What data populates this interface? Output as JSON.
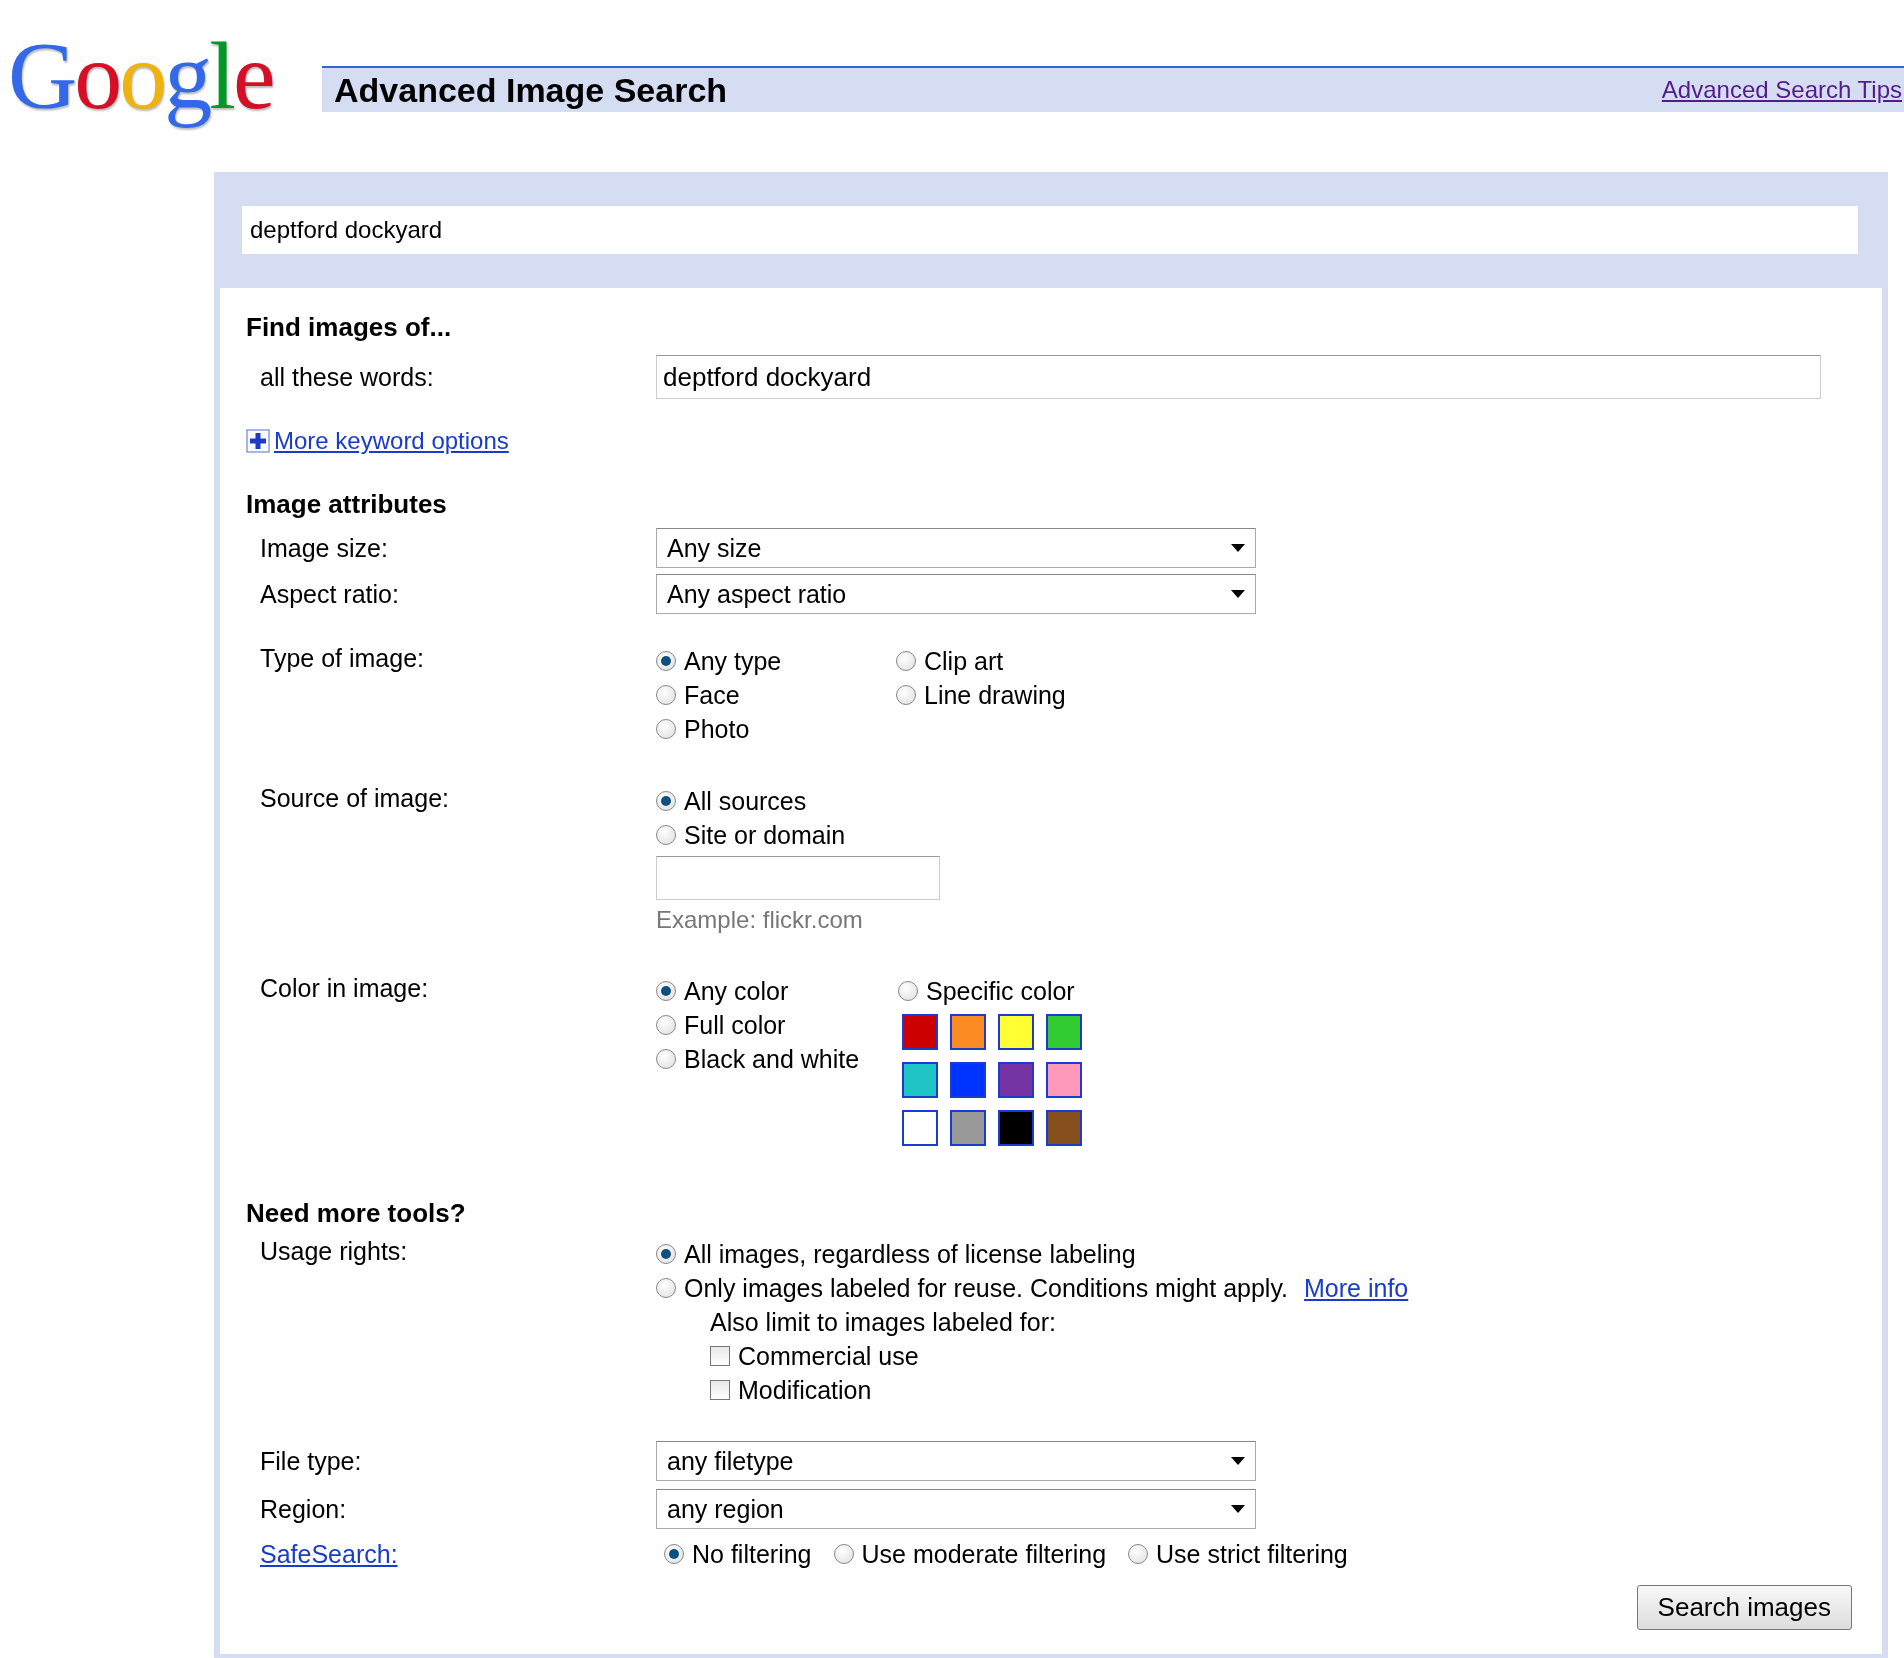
{
  "logo": "Google",
  "header": {
    "title": "Advanced Image Search",
    "tips_link": "Advanced Search Tips"
  },
  "top_query": {
    "value": "deptford dockyard"
  },
  "find_section": {
    "heading": "Find images of...",
    "label": "all these words:",
    "value": "deptford dockyard",
    "more_link": "More keyword options"
  },
  "attributes_section": {
    "heading": "Image attributes",
    "selects": [
      {
        "label": "Image size:",
        "value": "Any size"
      },
      {
        "label": "Aspect ratio:",
        "value": "Any aspect ratio"
      }
    ],
    "type_of_image": {
      "label": "Type of image:",
      "options": [
        {
          "label": "Any type",
          "selected": true
        },
        {
          "label": "Face",
          "selected": false
        },
        {
          "label": "Photo",
          "selected": false
        },
        {
          "label": "Clip art",
          "selected": false
        },
        {
          "label": "Line drawing",
          "selected": false
        }
      ]
    },
    "source_of_image": {
      "label": "Source of image:",
      "options": [
        {
          "label": "All sources",
          "selected": true
        },
        {
          "label": "Site or domain",
          "selected": false
        }
      ],
      "example": "Example: flickr.com"
    },
    "color_in_image": {
      "label": "Color in image:",
      "options": [
        {
          "label": "Any color",
          "selected": true
        },
        {
          "label": "Full color",
          "selected": false
        },
        {
          "label": "Black and white",
          "selected": false
        }
      ],
      "specific": {
        "label": "Specific color",
        "selected": false
      },
      "swatches": [
        {
          "color": "#cc0000"
        },
        {
          "color": "#fb8c24"
        },
        {
          "color": "#ffff33"
        },
        {
          "color": "#33cc33"
        },
        {
          "color": "#1fc4c4"
        },
        {
          "color": "#0033ff"
        },
        {
          "color": "#7633a3"
        },
        {
          "color": "#ff99bb"
        },
        {
          "color": "#ffffff"
        },
        {
          "color": "#999999"
        },
        {
          "color": "#000000"
        },
        {
          "color": "#85501e"
        }
      ]
    }
  },
  "tools_section": {
    "heading": "Need more tools?",
    "usage_rights": {
      "label": "Usage rights:",
      "options": [
        {
          "label": "All images, regardless of license labeling",
          "selected": true
        },
        {
          "label": "Only images labeled for reuse. Conditions might apply.",
          "selected": false
        }
      ],
      "more_info": "More info",
      "also_limit": "Also limit to images labeled for:",
      "checkboxes": [
        {
          "label": "Commercial use",
          "checked": false
        },
        {
          "label": "Modification",
          "checked": false
        }
      ]
    },
    "selects": [
      {
        "label": "File type:",
        "value": "any filetype"
      },
      {
        "label": "Region:",
        "value": "any region"
      }
    ],
    "safesearch": {
      "label": "SafeSearch:",
      "options": [
        {
          "label": "No filtering",
          "selected": true
        },
        {
          "label": "Use moderate filtering",
          "selected": false
        },
        {
          "label": "Use strict filtering",
          "selected": false
        }
      ]
    }
  },
  "search_button": "Search images"
}
